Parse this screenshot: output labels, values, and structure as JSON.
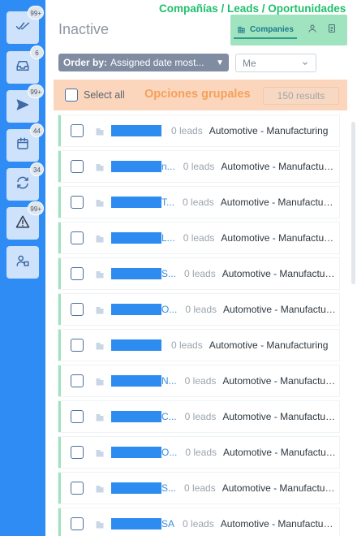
{
  "annotations": {
    "top": "Compañías / Leads / Oportunidades",
    "middle": "Opciones grupales"
  },
  "sidebar": {
    "items": [
      {
        "icon": "double-check-icon",
        "badge": "99+"
      },
      {
        "icon": "inbox-icon",
        "badge": "6"
      },
      {
        "icon": "send-icon",
        "badge": "99+"
      },
      {
        "icon": "calendar-icon",
        "badge": "44"
      },
      {
        "icon": "refresh-icon",
        "badge": "34"
      },
      {
        "icon": "warning-icon",
        "badge": "99+"
      },
      {
        "icon": "user-building-icon",
        "badge": ""
      }
    ]
  },
  "header": {
    "title": "Inactive",
    "view_switch": {
      "active_label": "Companies",
      "icons": [
        "building-icon",
        "person-icon",
        "document-icon"
      ]
    }
  },
  "filters": {
    "order_by_label": "Order by:",
    "order_by_value": "Assigned date most...",
    "owner_value": "Me"
  },
  "selection": {
    "select_all_label": "Select all",
    "results_label": "150 results"
  },
  "rows": [
    {
      "name": "",
      "leads": "0 leads",
      "industry": "Automotive - Manufacturing"
    },
    {
      "name": "n...",
      "leads": "0 leads",
      "industry": "Automotive - Manufacturing"
    },
    {
      "name": "T...",
      "leads": "0 leads",
      "industry": "Automotive - Manufacturing"
    },
    {
      "name": "L...",
      "leads": "0 leads",
      "industry": "Automotive - Manufacturing"
    },
    {
      "name": "S...",
      "leads": "0 leads",
      "industry": "Automotive - Manufacturing"
    },
    {
      "name": "O...",
      "leads": "0 leads",
      "industry": "Automotive - Manufacturing"
    },
    {
      "name": "",
      "leads": "0 leads",
      "industry": "Automotive - Manufacturing"
    },
    {
      "name": "N...",
      "leads": "0 leads",
      "industry": "Automotive - Manufacturing"
    },
    {
      "name": "C...",
      "leads": "0 leads",
      "industry": "Automotive - Manufacturing"
    },
    {
      "name": "O...",
      "leads": "0 leads",
      "industry": "Automotive - Manufacturing"
    },
    {
      "name": "S...",
      "leads": "0 leads",
      "industry": "Automotive - Manufacturing"
    },
    {
      "name": "SA",
      "leads": "0 leads",
      "industry": "Automotive - Manufacturing"
    }
  ],
  "colors": {
    "sidebar": "#2f8cf5",
    "row_accent": "#9fe3bf",
    "selection_bar": "#fbd6bd",
    "link": "#3b8ede",
    "redaction": "#2e8cf0"
  }
}
